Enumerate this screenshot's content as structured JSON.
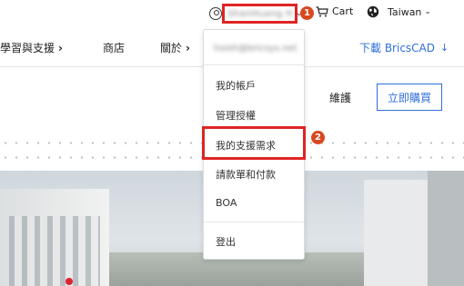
{
  "topbar": {
    "user_name": "ShanHuang H",
    "cart_label": "Cart",
    "language_label": "Taiwan"
  },
  "nav": {
    "items": [
      {
        "label": "學習與支援"
      },
      {
        "label": "商店"
      },
      {
        "label": "關於"
      }
    ],
    "download_label": "下載 BricsCAD"
  },
  "subheader": {
    "maintain_label": "維護",
    "buy_label": "立即購買"
  },
  "dropdown": {
    "email": "hsieh@bricsys.net",
    "items": [
      "我的帳戶",
      "管理授權",
      "我的支援需求",
      "請款單和付款",
      "BOA",
      "登出"
    ]
  },
  "annotations": {
    "step1": "1",
    "step2": "2",
    "highlight_color": "#e02424",
    "badge_color": "#d9481e"
  },
  "colors": {
    "accent": "#2f6fdb"
  }
}
